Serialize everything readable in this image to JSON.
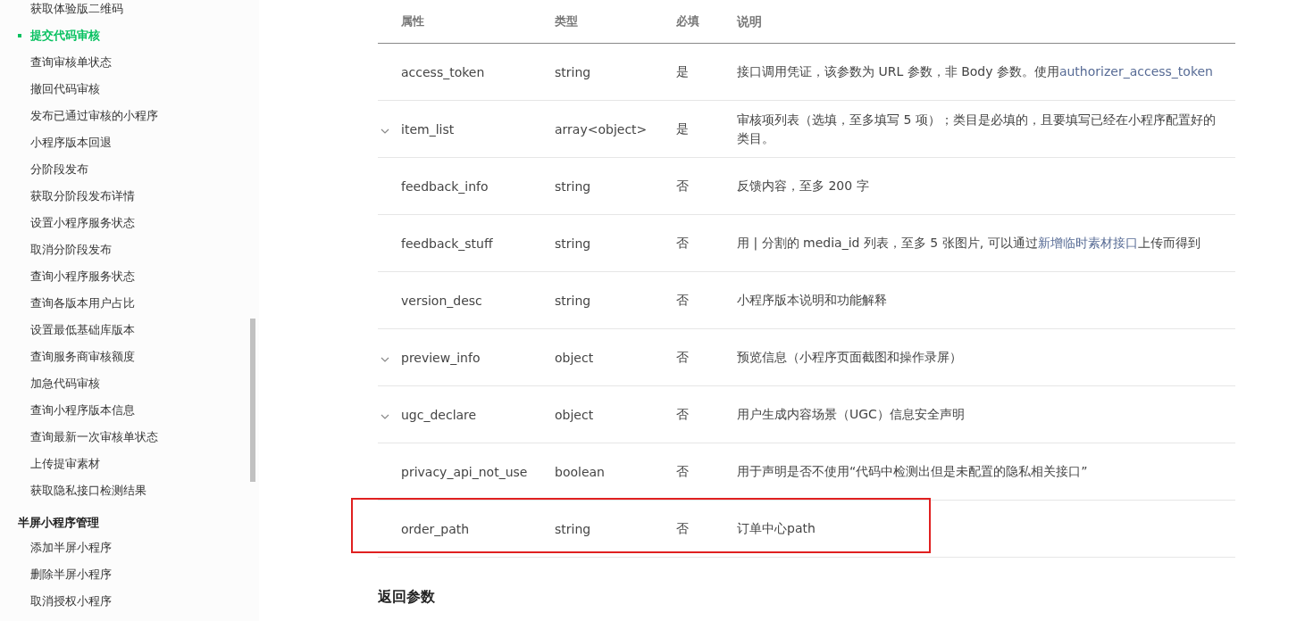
{
  "sidebar": {
    "items": [
      {
        "label": "获取体验版二维码",
        "selected": false
      },
      {
        "label": "提交代码审核",
        "selected": true
      },
      {
        "label": "查询审核单状态",
        "selected": false
      },
      {
        "label": "撤回代码审核",
        "selected": false
      },
      {
        "label": "发布已通过审核的小程序",
        "selected": false
      },
      {
        "label": "小程序版本回退",
        "selected": false
      },
      {
        "label": "分阶段发布",
        "selected": false
      },
      {
        "label": "获取分阶段发布详情",
        "selected": false
      },
      {
        "label": "设置小程序服务状态",
        "selected": false
      },
      {
        "label": "取消分阶段发布",
        "selected": false
      },
      {
        "label": "查询小程序服务状态",
        "selected": false
      },
      {
        "label": "查询各版本用户占比",
        "selected": false
      },
      {
        "label": "设置最低基础库版本",
        "selected": false
      },
      {
        "label": "查询服务商审核额度",
        "selected": false
      },
      {
        "label": "加急代码审核",
        "selected": false
      },
      {
        "label": "查询小程序版本信息",
        "selected": false
      },
      {
        "label": "查询最新一次审核单状态",
        "selected": false
      },
      {
        "label": "上传提审素材",
        "selected": false
      },
      {
        "label": "获取隐私接口检测结果",
        "selected": false
      }
    ],
    "group": {
      "title": "半屏小程序管理",
      "items": [
        {
          "label": "添加半屏小程序",
          "selected": false
        },
        {
          "label": "删除半屏小程序",
          "selected": false
        },
        {
          "label": "取消授权小程序",
          "selected": false
        }
      ]
    }
  },
  "table": {
    "columns": [
      "属性",
      "类型",
      "必填",
      "说明"
    ],
    "rows": [
      {
        "name": "access_token",
        "type": "string",
        "required": "是",
        "expandable": false,
        "highlighted": false,
        "description": [
          {
            "kind": "text",
            "text": "接口调用凭证，该参数为 URL 参数，非 Body 参数。使用"
          },
          {
            "kind": "link",
            "text": "authorizer_access_token"
          }
        ]
      },
      {
        "name": "item_list",
        "type": "array<object>",
        "required": "是",
        "expandable": true,
        "highlighted": false,
        "description": [
          {
            "kind": "text",
            "text": "审核项列表（选填，至多填写 5 项）；类目是必填的，且要填写已经在小程序配置好的类目。"
          }
        ]
      },
      {
        "name": "feedback_info",
        "type": "string",
        "required": "否",
        "expandable": false,
        "highlighted": false,
        "description": [
          {
            "kind": "text",
            "text": "反馈内容，至多 200 字"
          }
        ]
      },
      {
        "name": "feedback_stuff",
        "type": "string",
        "required": "否",
        "expandable": false,
        "highlighted": false,
        "description": [
          {
            "kind": "text",
            "text": "用 | 分割的 media_id 列表，至多 5 张图片, 可以通过"
          },
          {
            "kind": "link",
            "text": "新增临时素材接口"
          },
          {
            "kind": "text",
            "text": "上传而得到"
          }
        ]
      },
      {
        "name": "version_desc",
        "type": "string",
        "required": "否",
        "expandable": false,
        "highlighted": false,
        "description": [
          {
            "kind": "text",
            "text": "小程序版本说明和功能解释"
          }
        ]
      },
      {
        "name": "preview_info",
        "type": "object",
        "required": "否",
        "expandable": true,
        "highlighted": false,
        "description": [
          {
            "kind": "text",
            "text": "预览信息（小程序页面截图和操作录屏）"
          }
        ]
      },
      {
        "name": "ugc_declare",
        "type": "object",
        "required": "否",
        "expandable": true,
        "highlighted": false,
        "description": [
          {
            "kind": "text",
            "text": "用户生成内容场景（UGC）信息安全声明"
          }
        ]
      },
      {
        "name": "privacy_api_not_use",
        "type": "boolean",
        "required": "否",
        "expandable": false,
        "highlighted": false,
        "description": [
          {
            "kind": "text",
            "text": "用于声明是否不使用“代码中检测出但是未配置的隐私相关接口”"
          }
        ]
      },
      {
        "name": "order_path",
        "type": "string",
        "required": "否",
        "expandable": false,
        "highlighted": true,
        "description": [
          {
            "kind": "text",
            "text": "订单中心path"
          }
        ]
      }
    ]
  },
  "next_section": {
    "title": "返回参数"
  }
}
